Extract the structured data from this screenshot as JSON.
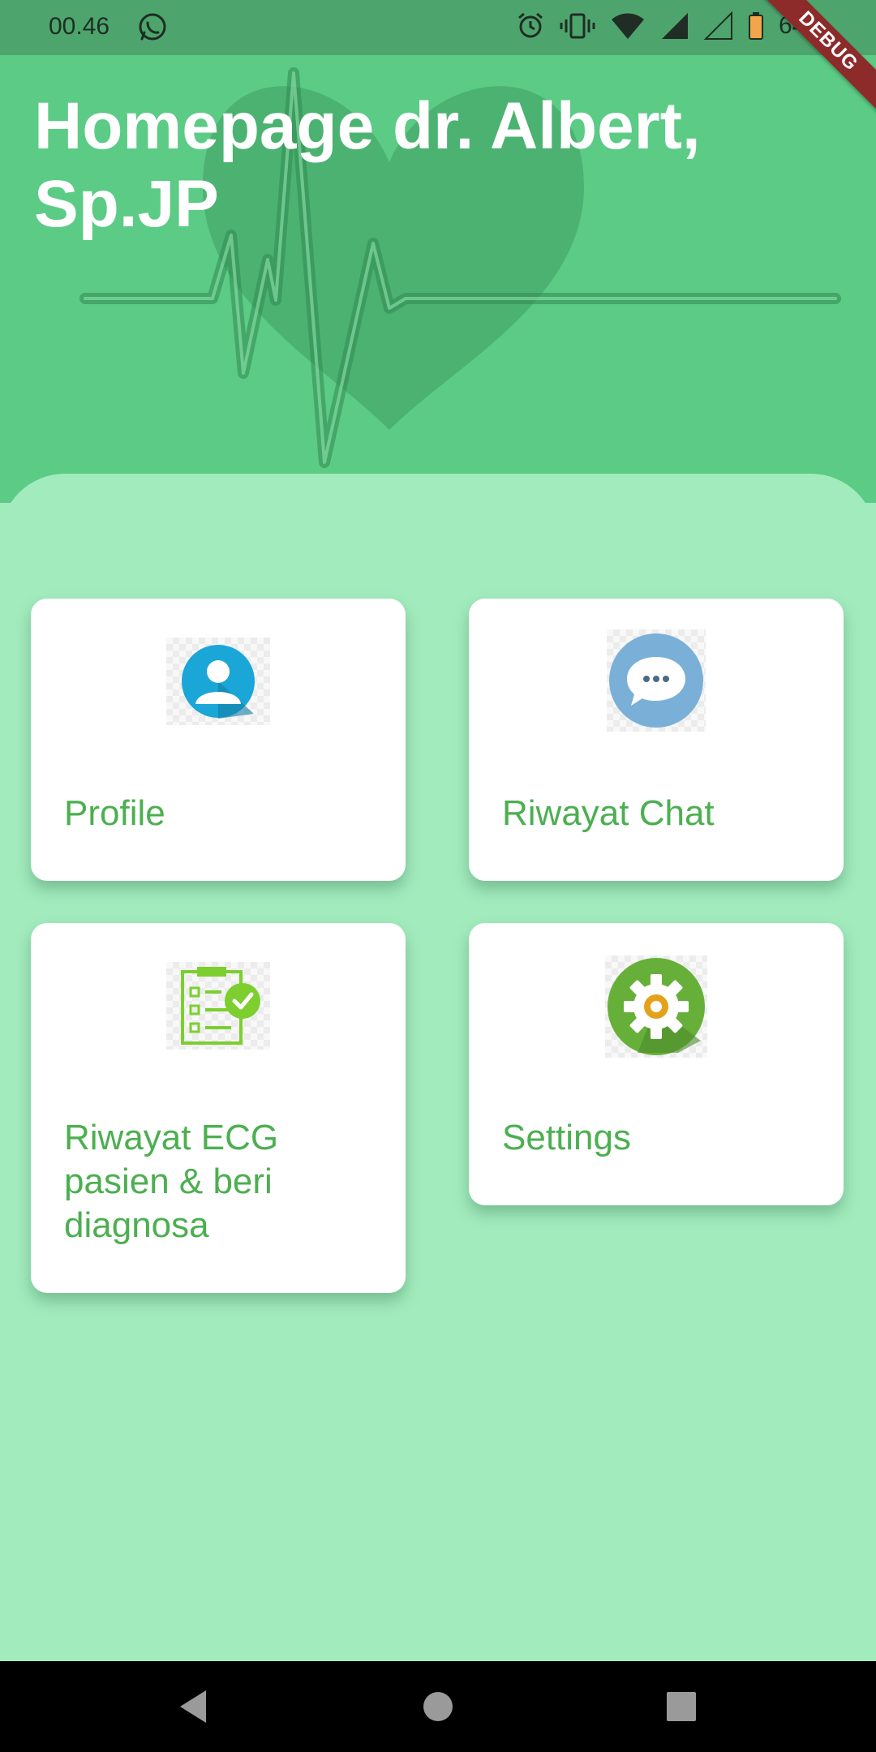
{
  "status_bar": {
    "time": "00.46",
    "battery_text": "64%",
    "debug_label": "DEBUG"
  },
  "header": {
    "title": "Homepage dr. Albert, Sp.JP"
  },
  "menu": {
    "items": [
      {
        "label": "Profile",
        "icon": "profile-icon"
      },
      {
        "label": "Riwayat Chat",
        "icon": "chat-icon"
      },
      {
        "label": "Riwayat ECG pasien & beri diagnosa",
        "icon": "clipboard-check-icon"
      },
      {
        "label": "Settings",
        "icon": "gear-icon"
      }
    ]
  },
  "navbar": {
    "buttons": [
      "back",
      "home",
      "recents"
    ]
  },
  "colors": {
    "header_green": "#5bcb86",
    "panel_mint": "#a2ebbd",
    "label_green": "#4caf50",
    "debug_red": "#8d2a2a"
  }
}
